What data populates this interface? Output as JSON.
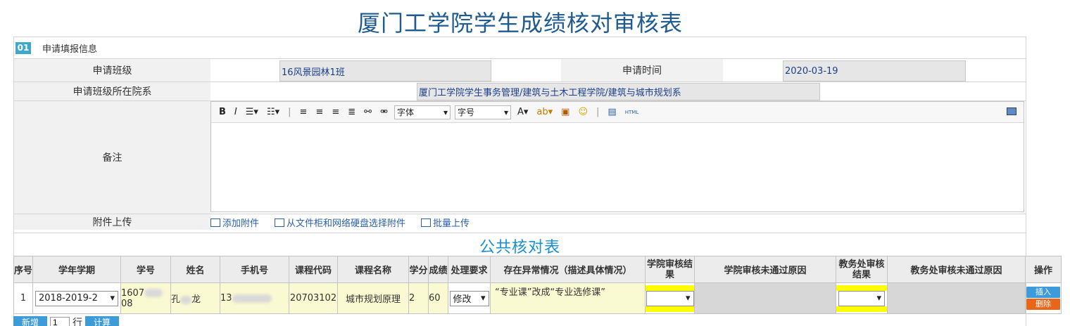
{
  "page_title": "厦门工学院学生成绩核对审核表",
  "section": {
    "number": "01",
    "label": "申请填报信息"
  },
  "form": {
    "class_label": "申请班级",
    "class_value": "16风景园林1班",
    "time_label": "申请时间",
    "time_value": "2020-03-19",
    "dept_label": "申请班级所在院系",
    "dept_value": "厦门工学院学生事务管理/建筑与土木工程学院/建筑与城市规划系",
    "remark_label": "备注",
    "attach_label": "附件上传"
  },
  "editor": {
    "font_select": "字体",
    "size_select": "字号",
    "bold": "B",
    "italic": "I",
    "font_color": "A",
    "html_label": "HTML"
  },
  "attachments": {
    "add": "添加附件",
    "cabinet": "从文件柜和网络硬盘选择附件",
    "batch": "批量上传"
  },
  "public_table_title": "公共核对表",
  "table": {
    "headers": [
      "序号",
      "学年学期",
      "学号",
      "姓名",
      "手机号",
      "课程代码",
      "课程名称",
      "学分",
      "成绩",
      "处理要求",
      "存在异常情况（描述具体情况）",
      "学院审核结果",
      "学院审核未通过原因",
      "教务处审核结果",
      "教务处审核未通过原因",
      "操作"
    ],
    "rows": [
      {
        "index": "1",
        "term": "2018-2019-2",
        "student_id_a": "1607",
        "student_id_b": "08",
        "name_a": "孔",
        "name_b": "龙",
        "phone_prefix": "13",
        "course_code": "20703102",
        "course_name": "城市规划原理",
        "credit": "2",
        "score": "60",
        "action_req": "修改",
        "anomaly": "“专业课”改成“专业选修课”",
        "college_result": "",
        "college_reason": "",
        "office_result": "",
        "office_reason": ""
      }
    ],
    "insert_label": "插入",
    "delete_label": "删除"
  },
  "footer": {
    "new_label": "新增",
    "row_count": "1",
    "row_unit": "行",
    "calc_label": "计算"
  },
  "colors": {
    "title": "#1f5b8f",
    "accent": "#3ea8c9",
    "public_title": "#1b8fcf",
    "button_blue": "#3e9bd9",
    "button_orange": "#e8661a",
    "highlight_yellow": "#ffff00",
    "cell_yellow": "#fafad2"
  }
}
